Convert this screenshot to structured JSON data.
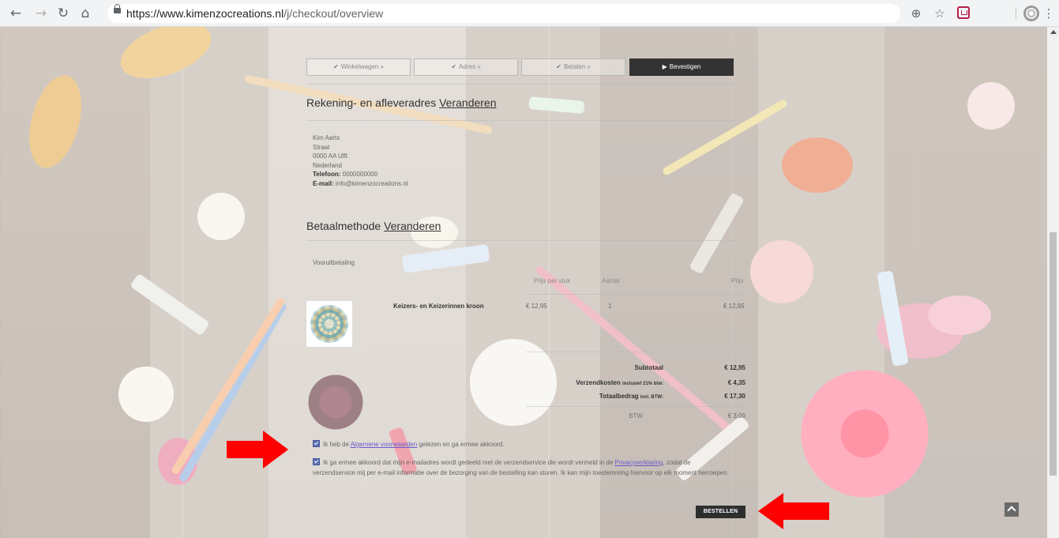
{
  "browser": {
    "url_host": "https://www.kimenzocreations.nl",
    "url_path": "/j/checkout/overview"
  },
  "steps": [
    {
      "label": "Winkelwagen",
      "suffix": "»",
      "active": false
    },
    {
      "label": "Adres",
      "suffix": "»",
      "active": false
    },
    {
      "label": "Betalen",
      "suffix": "»",
      "active": false
    },
    {
      "label": "Bevestigen",
      "suffix": "",
      "active": true
    }
  ],
  "address_section": {
    "title": "Rekening- en afleveradres",
    "change_link": "Veranderen",
    "name": "Kim Aarts",
    "street": "Straat",
    "postal_city": "0000 AA Ulft",
    "country": "Nederland",
    "phone_label": "Telefoon:",
    "phone": "0000000000",
    "email_label": "E-mail:",
    "email": "info@kimenzocreations.nl"
  },
  "payment_section": {
    "title": "Betaalmethode",
    "change_link": "Veranderen",
    "method": "Vooruitbetaling"
  },
  "table": {
    "headers": {
      "unit_price": "Prijs per stuk",
      "quantity": "Aantal",
      "price": "Prijs"
    },
    "rows": [
      {
        "product": "Keizers- en Keizerinnen kroon",
        "unit_price": "€ 12,95",
        "quantity": "1",
        "price": "€ 12,95"
      }
    ]
  },
  "totals": {
    "subtotal_label": "Subtotaal",
    "subtotal": "€ 12,95",
    "shipping_label": "Verzendkosten",
    "shipping_note": "inclusief 21% btw:",
    "shipping": "€ 4,35",
    "total_label": "Totaalbedrag",
    "total_note": "incl. BTW:",
    "total": "€ 17,30",
    "vat_label": "BTW",
    "vat": "€ 3,00"
  },
  "agreements": {
    "terms_prefix": "Ik heb de",
    "terms_link": "Algemene voorwaarden",
    "terms_suffix": "gelezen en ga ermee akkoord.",
    "privacy_prefix": "Ik ga ermee akkoord dat mijn e-mailadres wordt gedeeld met de verzendservice die wordt vermeld in de",
    "privacy_link": "Privacyverklaring",
    "privacy_suffix": ", zodat de verzendservice mij per e-mail informatie over de bezorging van de bestelling kan sturen. Ik kan mijn toestemming hiervoor op elk moment herroepen."
  },
  "order_button": "BESTELLEN",
  "colors": {
    "annotation_arrow": "#ff0000",
    "active_step": "#333333",
    "checkbox": "#5b6fb5"
  }
}
